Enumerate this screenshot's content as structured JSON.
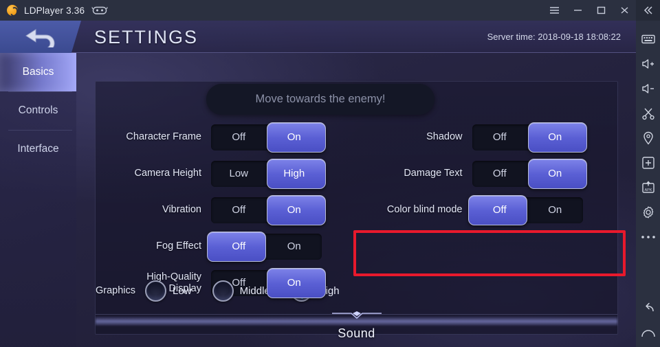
{
  "window": {
    "app_title": "LDPlayer 3.36",
    "logo_icon": "ldplayer-logo-icon",
    "gamepad_icon": "gamepad-icon",
    "controls": {
      "menu_label": "☰",
      "minimize_label": "—",
      "maximize_label": "□",
      "close_label": "✕",
      "collapse_label": "«"
    }
  },
  "toolbar": {
    "items": [
      {
        "icon": "keyboard-icon",
        "label": "Keyboard"
      },
      {
        "icon": "volume-up-icon",
        "label": "Volume up"
      },
      {
        "icon": "volume-down-icon",
        "label": "Volume down"
      },
      {
        "icon": "scissors-icon",
        "label": "Screenshot"
      },
      {
        "icon": "location-pin-icon",
        "label": "Location"
      },
      {
        "icon": "multi-window-icon",
        "label": "Multi window"
      },
      {
        "icon": "apk-install-icon",
        "label": "Install APK"
      },
      {
        "icon": "gear-icon",
        "label": "Settings"
      },
      {
        "icon": "more-dots-icon",
        "label": "More"
      },
      {
        "icon": "back-arrow-icon",
        "label": "Back"
      },
      {
        "icon": "home-icon",
        "label": "Home"
      }
    ]
  },
  "game": {
    "header": {
      "back_icon": "back-arrow-icon",
      "title": "SETTINGS",
      "server_time": "Server time: 2018-09-18 18:08:22"
    },
    "tabs": [
      {
        "label": "Basics",
        "active": true
      },
      {
        "label": "Controls",
        "active": false
      },
      {
        "label": "Interface",
        "active": false
      }
    ],
    "tooltip": {
      "text": "Move towards the enemy!"
    },
    "sections": {
      "graphics_title": "Graphics",
      "sound_title": "Sound"
    },
    "settings_left": [
      {
        "label": "Character Frame",
        "options": [
          "Off",
          "On"
        ],
        "selected": "On"
      },
      {
        "label": "Camera Height",
        "options": [
          "Low",
          "High"
        ],
        "selected": "High"
      },
      {
        "label": "Vibration",
        "options": [
          "Off",
          "On"
        ],
        "selected": "On"
      },
      {
        "label": "Fog Effect",
        "options": [
          "Off",
          "On"
        ],
        "selected": "Off"
      },
      {
        "label": "High-Quality\nDisplay",
        "options": [
          "Off",
          "On"
        ],
        "selected": "On"
      }
    ],
    "settings_right": [
      {
        "label": "Shadow",
        "options": [
          "Off",
          "On"
        ],
        "selected": "On"
      },
      {
        "label": "Damage Text",
        "options": [
          "Off",
          "On"
        ],
        "selected": "On"
      },
      {
        "label": "Color blind mode",
        "options": [
          "Off",
          "On"
        ],
        "selected": "Off"
      }
    ],
    "graphics_quality": {
      "label": "Graphics",
      "options": [
        {
          "label": "Low",
          "selected": false
        },
        {
          "label": "Middle",
          "selected": false
        },
        {
          "label": "High",
          "selected": true
        }
      ]
    },
    "annotation": {
      "color": "#e8192c",
      "shape": "rectangle"
    }
  }
}
